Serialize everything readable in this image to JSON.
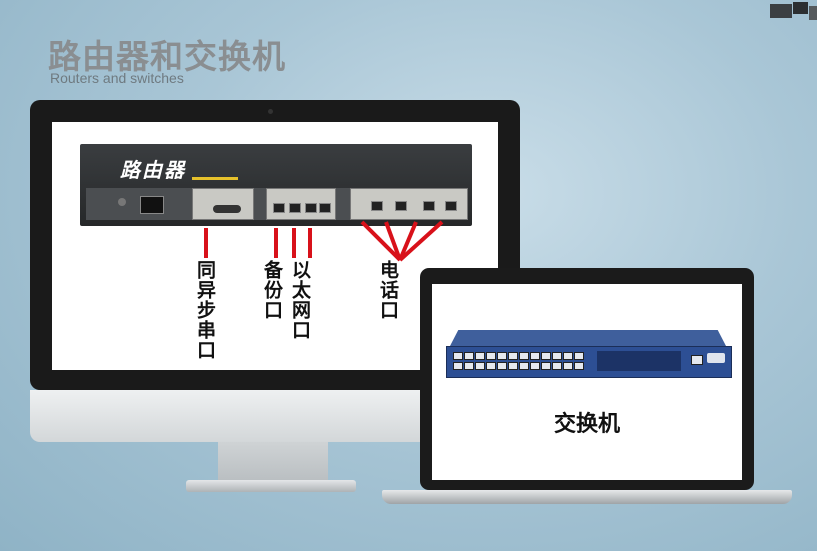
{
  "header": {
    "title": "路由器和交换机",
    "subtitle": "Routers and switches"
  },
  "router": {
    "label": "路由器",
    "ports": {
      "sync_serial": "同异步串口",
      "backup": "备份口",
      "ethernet": "以太网口",
      "phone": "电话口"
    }
  },
  "switch": {
    "label": "交换机"
  },
  "colors": {
    "pointer_lines": "#d8111a",
    "router_brand_strip": "#e6c12b",
    "switch_body": "#2d4f94"
  }
}
